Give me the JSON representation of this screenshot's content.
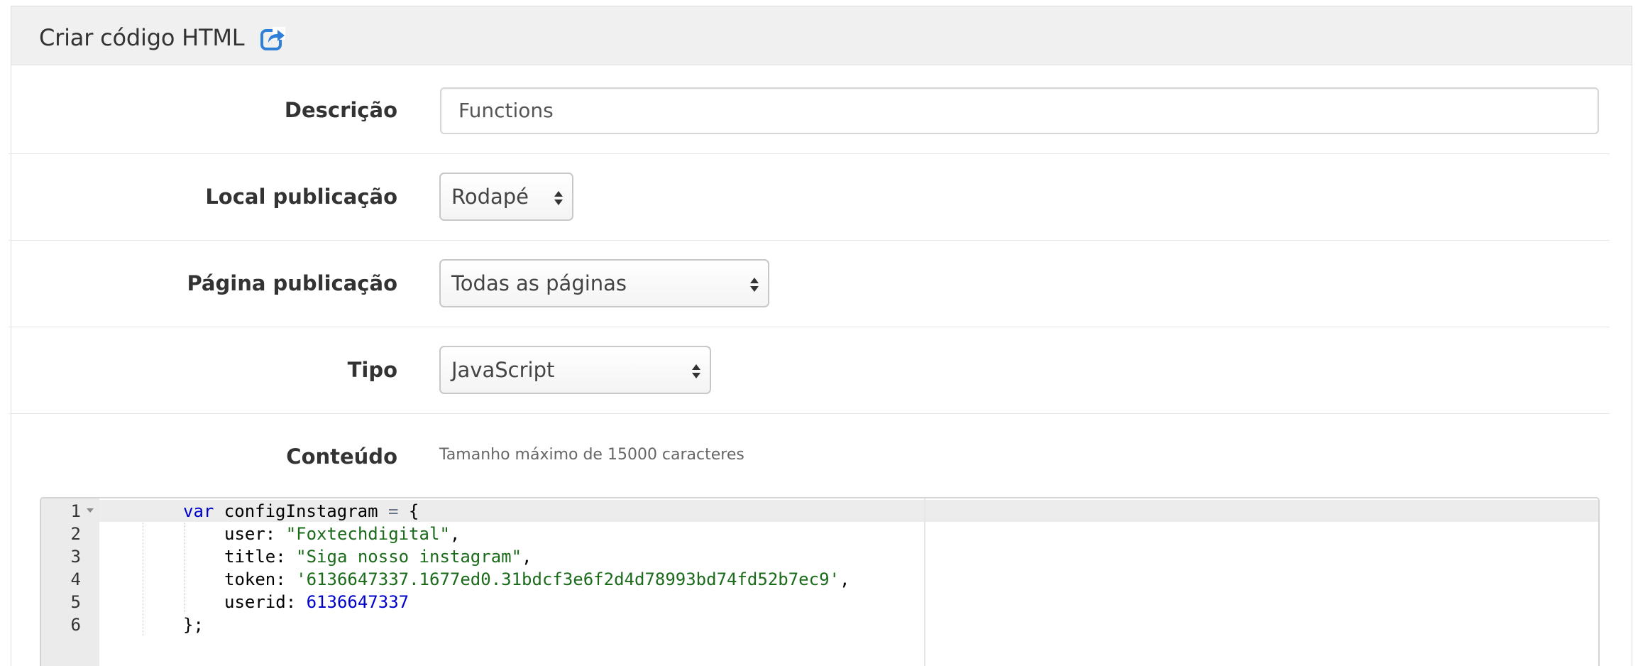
{
  "panel": {
    "title": "Criar código HTML",
    "icon": "share-external-icon"
  },
  "form": {
    "descricao": {
      "label": "Descrição",
      "value": "Functions"
    },
    "local": {
      "label": "Local publicação",
      "selected": "Rodapé"
    },
    "pagina": {
      "label": "Página publicação",
      "selected": "Todas as páginas"
    },
    "tipo": {
      "label": "Tipo",
      "selected": "JavaScript"
    },
    "conteudo": {
      "label": "Conteúdo",
      "hint": "Tamanho máximo de 15000 caracteres"
    }
  },
  "editor": {
    "line_numbers": [
      "1",
      "2",
      "3",
      "4",
      "5",
      "6"
    ],
    "code": {
      "l1_kw": "var",
      "l1_rest": " configInstagram ",
      "l1_eq": "=",
      "l1_brace": " {",
      "l2_key": "user: ",
      "l2_val": "\"Foxtechdigital\"",
      "l2_end": ",",
      "l3_key": "title: ",
      "l3_val": "\"Siga nosso instagram\"",
      "l3_end": ",",
      "l4_key": "token: ",
      "l4_val": "'6136647337.1677ed0.31bdcf3e6f2d4d78993bd74fd52b7ec9'",
      "l4_end": ",",
      "l5_key": "userid: ",
      "l5_val": "6136647337",
      "l6": "};"
    }
  },
  "colors": {
    "keyword": "#0000cc",
    "string": "#1a6b1a",
    "number": "#0000cd",
    "icon_blue": "#2f7ed8"
  }
}
